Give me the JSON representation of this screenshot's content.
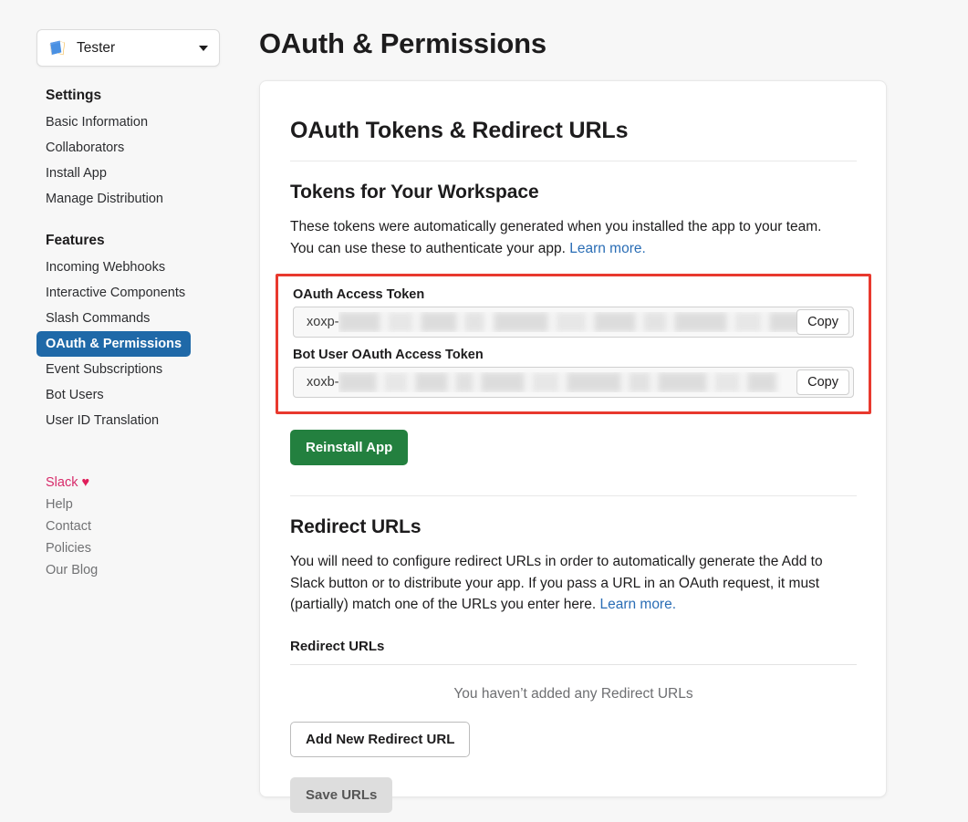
{
  "sidebar": {
    "app_selector": {
      "icon": "app-book-icon",
      "name": "Tester",
      "caret": "chevron-down-icon"
    },
    "groups": [
      {
        "title": "Settings",
        "items": [
          {
            "label": "Basic Information",
            "active": false
          },
          {
            "label": "Collaborators",
            "active": false
          },
          {
            "label": "Install App",
            "active": false
          },
          {
            "label": "Manage Distribution",
            "active": false
          }
        ]
      },
      {
        "title": "Features",
        "items": [
          {
            "label": "Incoming Webhooks",
            "active": false
          },
          {
            "label": "Interactive Components",
            "active": false
          },
          {
            "label": "Slash Commands",
            "active": false
          },
          {
            "label": "OAuth & Permissions",
            "active": true
          },
          {
            "label": "Event Subscriptions",
            "active": false
          },
          {
            "label": "Bot Users",
            "active": false
          },
          {
            "label": "User ID Translation",
            "active": false
          }
        ]
      }
    ],
    "footer_links": [
      {
        "label": "Slack",
        "heart": "♥",
        "brand": true
      },
      {
        "label": "Help",
        "brand": false
      },
      {
        "label": "Contact",
        "brand": false
      },
      {
        "label": "Policies",
        "brand": false
      },
      {
        "label": "Our Blog",
        "brand": false
      }
    ]
  },
  "main": {
    "page_title": "OAuth & Permissions",
    "card_title": "OAuth Tokens & Redirect URLs",
    "tokens_section": {
      "title": "Tokens for Your Workspace",
      "description_line1": "These tokens were automatically generated when you installed the app to your team.",
      "description_line2": "You can use these to authenticate your app. ",
      "learn_more": "Learn more.",
      "fields": [
        {
          "label": "OAuth Access Token",
          "prefix": "xoxp-",
          "value_masked": true,
          "copy_label": "Copy"
        },
        {
          "label": "Bot User OAuth Access Token",
          "prefix": "xoxb-",
          "value_masked": true,
          "copy_label": "Copy"
        }
      ],
      "reinstall_label": "Reinstall App"
    },
    "redirect_section": {
      "title": "Redirect URLs",
      "description_line1": "You will need to configure redirect URLs in order to automatically generate the Add to",
      "description_line2": "Slack button or to distribute your app. If you pass a URL in an OAuth request, it must",
      "description_line3": "(partially) match one of the URLs you enter here. ",
      "learn_more": "Learn more.",
      "sub_label": "Redirect URLs",
      "empty_note": "You haven’t added any Redirect URLs",
      "add_label": "Add New Redirect URL",
      "save_label": "Save URLs"
    }
  },
  "colors": {
    "page_background": "#f7f7f7",
    "nav_active": "#1f69a8",
    "link": "#2a6db5",
    "highlight_border": "#e8392e",
    "primary_button": "#23803f",
    "slack_brand": "#d72b6a"
  }
}
